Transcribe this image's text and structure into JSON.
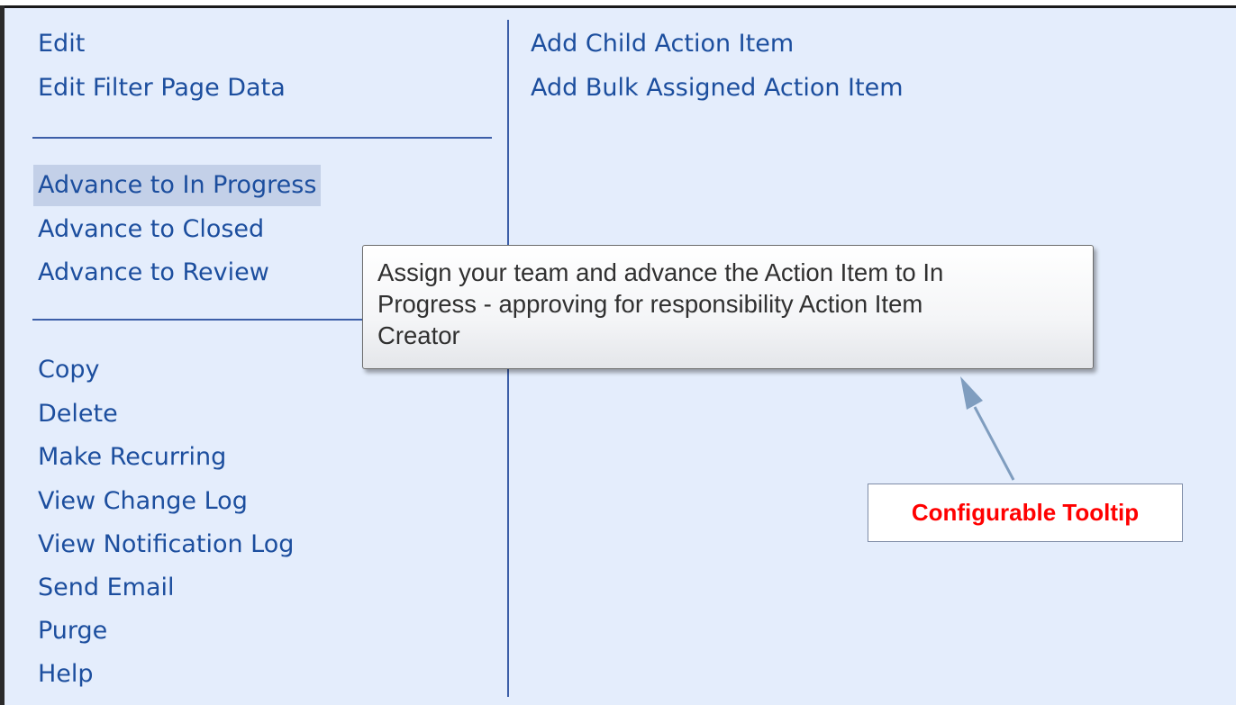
{
  "menu": {
    "left_group_1": [
      "Edit",
      "Edit Filter Page Data"
    ],
    "left_group_2": [
      "Advance to In Progress",
      "Advance to Closed",
      "Advance to Review"
    ],
    "left_group_3": [
      "Copy",
      "Delete",
      "Make Recurring",
      "View Change Log",
      "View Notification Log",
      "Send Email",
      "Purge",
      "Help"
    ],
    "right_group": [
      "Add Child Action Item",
      "Add Bulk Assigned Action Item"
    ],
    "highlighted_item": "Advance to In Progress"
  },
  "tooltip": {
    "lines": [
      "Assign your team and advance the Action Item to In",
      "Progress - approving for responsibility Action Item",
      "Creator"
    ]
  },
  "annotation": {
    "label": "Configurable Tooltip"
  },
  "colors": {
    "panel_background": "#e4edfc",
    "menu_text": "#1c4e9e",
    "divider": "#3c5ea8",
    "highlight": "#c3d0e8",
    "annotation_text": "#ff0000",
    "arrow": "#7f9dbf"
  }
}
